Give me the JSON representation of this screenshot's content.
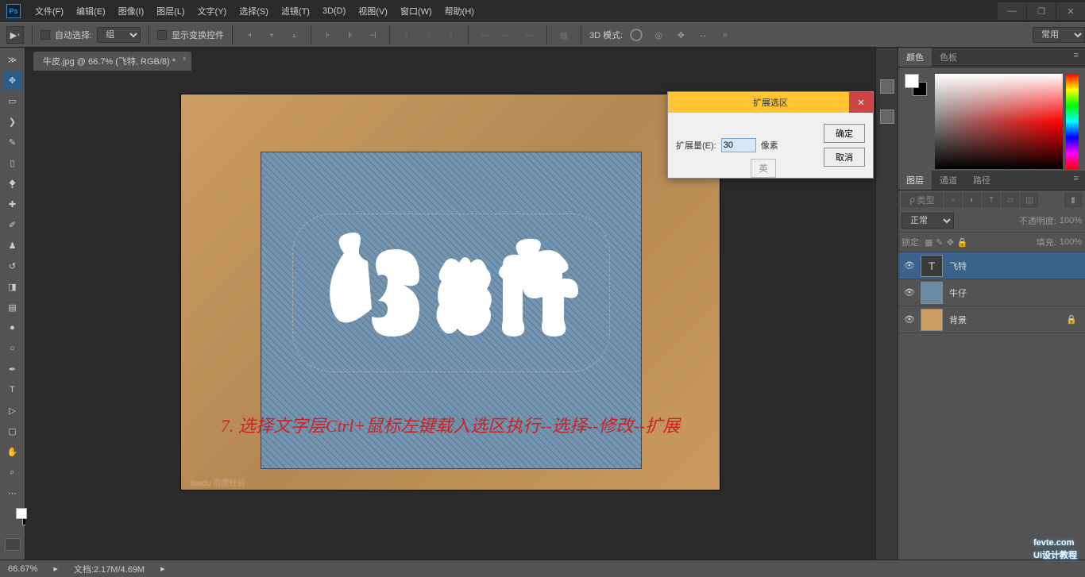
{
  "menu": {
    "file": "文件(F)",
    "edit": "编辑(E)",
    "image": "图像(I)",
    "layer": "图层(L)",
    "type": "文字(Y)",
    "select": "选择(S)",
    "filter": "滤镜(T)",
    "threeD": "3D(D)",
    "view": "视图(V)",
    "window": "窗口(W)",
    "help": "帮助(H)"
  },
  "options": {
    "auto_select": "自动选择:",
    "group": "组",
    "show_transform": "显示变换控件",
    "mode3d_label": "3D 模式:",
    "preset": "常用"
  },
  "doc_tab": {
    "title": "牛皮.jpg @ 66.7% (飞特, RGB/8) *"
  },
  "dialog": {
    "title": "扩展选区",
    "expand_by": "扩展量(E):",
    "value": "30",
    "pixels": "像素",
    "ok": "确定",
    "cancel": "取消",
    "ime": "英"
  },
  "caption": "7. 选择文字层Ctrl+鼠标左键载入选区执行--选择--修改--扩展",
  "panels": {
    "color_tab": "颜色",
    "swatch_tab": "色板",
    "layers_tab": "图层",
    "channels_tab": "通道",
    "paths_tab": "路径",
    "kind": "类型",
    "normal": "正常",
    "opacity_label": "不透明度:",
    "opacity_value": "100%",
    "lock_label": "锁定:",
    "fill_label": "填充:",
    "fill_value": "100%",
    "filter_search": "ρ"
  },
  "layers": [
    {
      "name": "飞特",
      "type": "text",
      "selected": true
    },
    {
      "name": "牛仔",
      "type": "denim"
    },
    {
      "name": "背景",
      "type": "leather",
      "locked": true
    }
  ],
  "status": {
    "zoom": "66.67%",
    "docinfo": "文档:2.17M/4.69M"
  },
  "watermarks": {
    "bottom_left": "Baidu 百度经验",
    "corner": "fevte.com",
    "corner2": "Ui设计教程"
  }
}
